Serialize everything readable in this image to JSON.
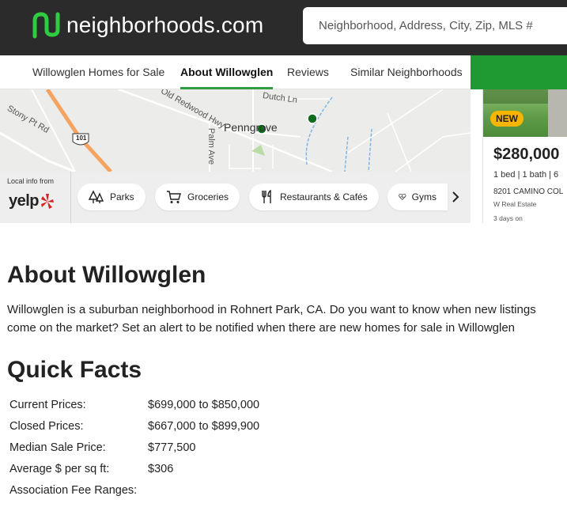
{
  "header": {
    "logo_text": "neighborhoods.com",
    "search_placeholder": "Neighborhood, Address, City, Zip, MLS #"
  },
  "tabs": [
    {
      "label": "Willowglen Homes for Sale",
      "active": false
    },
    {
      "label": "About Willowglen",
      "active": true
    },
    {
      "label": "Reviews",
      "active": false
    },
    {
      "label": "Similar Neighborhoods",
      "active": false
    }
  ],
  "map": {
    "labels": [
      "Dutch Ln",
      "Old Redwood Hwy",
      "Stony Pt Rd",
      "Penngrove",
      "Palm Ave",
      "101"
    ]
  },
  "local_info": {
    "caption": "Local info from",
    "brand": "yelp",
    "categories": [
      {
        "label": "Parks",
        "icon": "trees-icon"
      },
      {
        "label": "Groceries",
        "icon": "cart-icon"
      },
      {
        "label": "Restaurants & Cafés",
        "icon": "utensils-icon"
      },
      {
        "label": "Gyms",
        "icon": "heartbeat-icon"
      }
    ]
  },
  "listing": {
    "badge": "NEW",
    "price": "$280,000",
    "facts": "1 bed | 1 bath | 6",
    "address": "8201 CAMINO COL",
    "broker": "W Real Estate",
    "posted": "3 days on"
  },
  "about": {
    "title": "About Willowglen",
    "description": "Willowglen is a suburban neighborhood in Rohnert Park, CA. Do you want to know when new listings come on the market? Set an alert to be notified when there are new homes for sale in Willowglen"
  },
  "quick_facts": {
    "title": "Quick Facts",
    "rows": [
      {
        "label": "Current Prices:",
        "value": "$699,000 to $850,000"
      },
      {
        "label": "Closed Prices:",
        "value": "$667,000 to $899,900"
      },
      {
        "label": "Median Sale Price:",
        "value": "$777,500"
      },
      {
        "label": "Average $ per sq ft:",
        "value": "$306"
      },
      {
        "label": "Association Fee Ranges:",
        "value": ""
      }
    ]
  },
  "colors": {
    "header_bg": "#2b2b2b",
    "brand_green": "#1f9a33",
    "badge_yellow": "#f7b500"
  }
}
